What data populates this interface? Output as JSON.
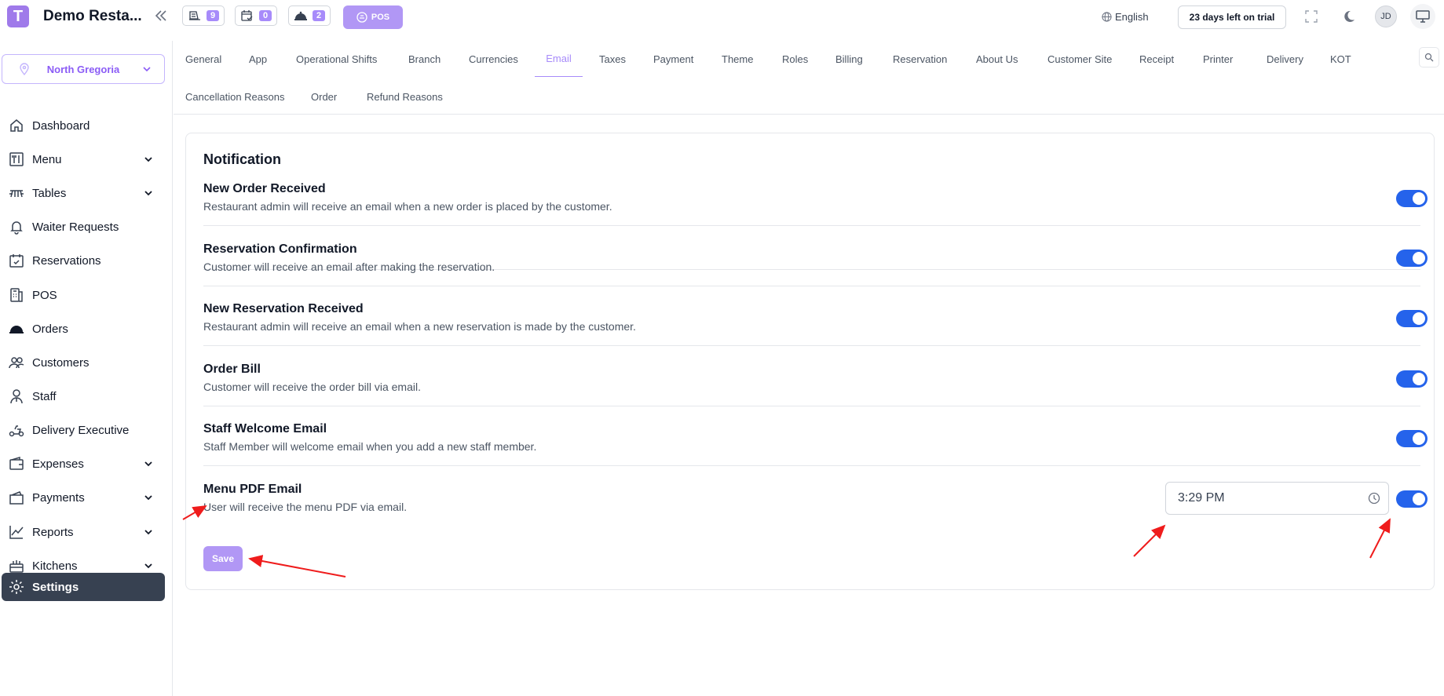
{
  "header": {
    "logo_letter": "T",
    "app_title": "Demo Resta...",
    "counters": [
      {
        "icon": "kitchen-order-icon",
        "count": "9"
      },
      {
        "icon": "calendar-check-icon",
        "count": "0"
      },
      {
        "icon": "cloche-icon",
        "count": "2"
      }
    ],
    "pos_label": "POS",
    "language": "English",
    "trial_label": "23 days left on trial",
    "avatar_initials": "JD"
  },
  "sidebar": {
    "branch": "North Gregoria",
    "items": [
      {
        "label": "Dashboard",
        "icon": "home-icon",
        "expandable": false
      },
      {
        "label": "Menu",
        "icon": "menu-icon",
        "expandable": true
      },
      {
        "label": "Tables",
        "icon": "table-icon",
        "expandable": true
      },
      {
        "label": "Waiter Requests",
        "icon": "bell-icon",
        "expandable": false
      },
      {
        "label": "Reservations",
        "icon": "calendar-icon",
        "expandable": false
      },
      {
        "label": "POS",
        "icon": "pos-icon",
        "expandable": false
      },
      {
        "label": "Orders",
        "icon": "cloche-icon",
        "expandable": false
      },
      {
        "label": "Customers",
        "icon": "users-icon",
        "expandable": false
      },
      {
        "label": "Staff",
        "icon": "staff-icon",
        "expandable": false
      },
      {
        "label": "Delivery Executive",
        "icon": "scooter-icon",
        "expandable": false
      },
      {
        "label": "Expenses",
        "icon": "wallet-icon",
        "expandable": true
      },
      {
        "label": "Payments",
        "icon": "wallet-icon",
        "expandable": true
      },
      {
        "label": "Reports",
        "icon": "chart-icon",
        "expandable": true
      },
      {
        "label": "Kitchens",
        "icon": "kitchen-icon",
        "expandable": true
      },
      {
        "label": "Settings",
        "icon": "gear-icon",
        "expandable": false,
        "active": true
      }
    ]
  },
  "tabs": {
    "row1": [
      "General",
      "App",
      "Operational Shifts",
      "Branch",
      "Currencies",
      "Email",
      "Taxes",
      "Payment",
      "Theme",
      "Roles",
      "Billing",
      "Reservation",
      "About Us",
      "Customer Site",
      "Receipt",
      "Printer",
      "Delivery",
      "KOT"
    ],
    "row2": [
      "Cancellation Reasons",
      "Order",
      "Refund Reasons"
    ],
    "active": "Email"
  },
  "notification": {
    "title": "Notification",
    "rows": [
      {
        "title": "New Order Received",
        "desc": "Restaurant admin will receive an email when a new order is placed by the customer.",
        "enabled": true
      },
      {
        "title": "Reservation Confirmation",
        "desc": "Customer will receive an email after making the reservation.",
        "enabled": true
      },
      {
        "title": "New Reservation Received",
        "desc": "Restaurant admin will receive an email when a new reservation is made by the customer.",
        "enabled": true
      },
      {
        "title": "Order Bill",
        "desc": "Customer will receive the order bill via email.",
        "enabled": true
      },
      {
        "title": "Staff Welcome Email",
        "desc": "Staff Member will welcome email when you add a new staff member.",
        "enabled": true
      },
      {
        "title": "Menu PDF Email",
        "desc": "User will receive the menu PDF via email.",
        "enabled": true
      }
    ],
    "menu_pdf_time": "3:29 PM",
    "save_label": "Save"
  },
  "colors": {
    "accent": "#a78bfa",
    "toggle_on": "#2563eb",
    "sidebar_active": "#374151",
    "annotation": "#ef1c1c"
  }
}
